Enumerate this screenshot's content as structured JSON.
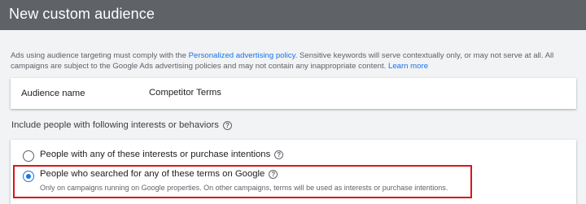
{
  "header": {
    "title": "New custom audience"
  },
  "policy": {
    "text_before_link": "Ads using audience targeting must comply with the ",
    "link": "Personalized advertising policy",
    "text_after_link": ". Sensitive keywords will serve contextually only, or may not serve at all. All campaigns are subject to the Google Ads advertising policies and may not contain any inappropriate content. ",
    "learn_more": "Learn more"
  },
  "audience_name": {
    "label": "Audience name",
    "value": "Competitor Terms"
  },
  "include": {
    "label": "Include people with following interests or behaviors"
  },
  "options": [
    {
      "label": "People with any of these interests or purchase intentions",
      "selected": false
    },
    {
      "label": "People who searched for any of these terms on Google",
      "selected": true,
      "description": "Only on campaigns running on Google properties. On other campaigns, terms will be used as interests or purchase intentions."
    }
  ],
  "colors": {
    "header_bg": "#5f6368",
    "link": "#1a73e8",
    "radio_selected": "#1a73e8",
    "highlight_border": "#d9161c"
  },
  "icons": {
    "help": "help-circle-icon"
  }
}
